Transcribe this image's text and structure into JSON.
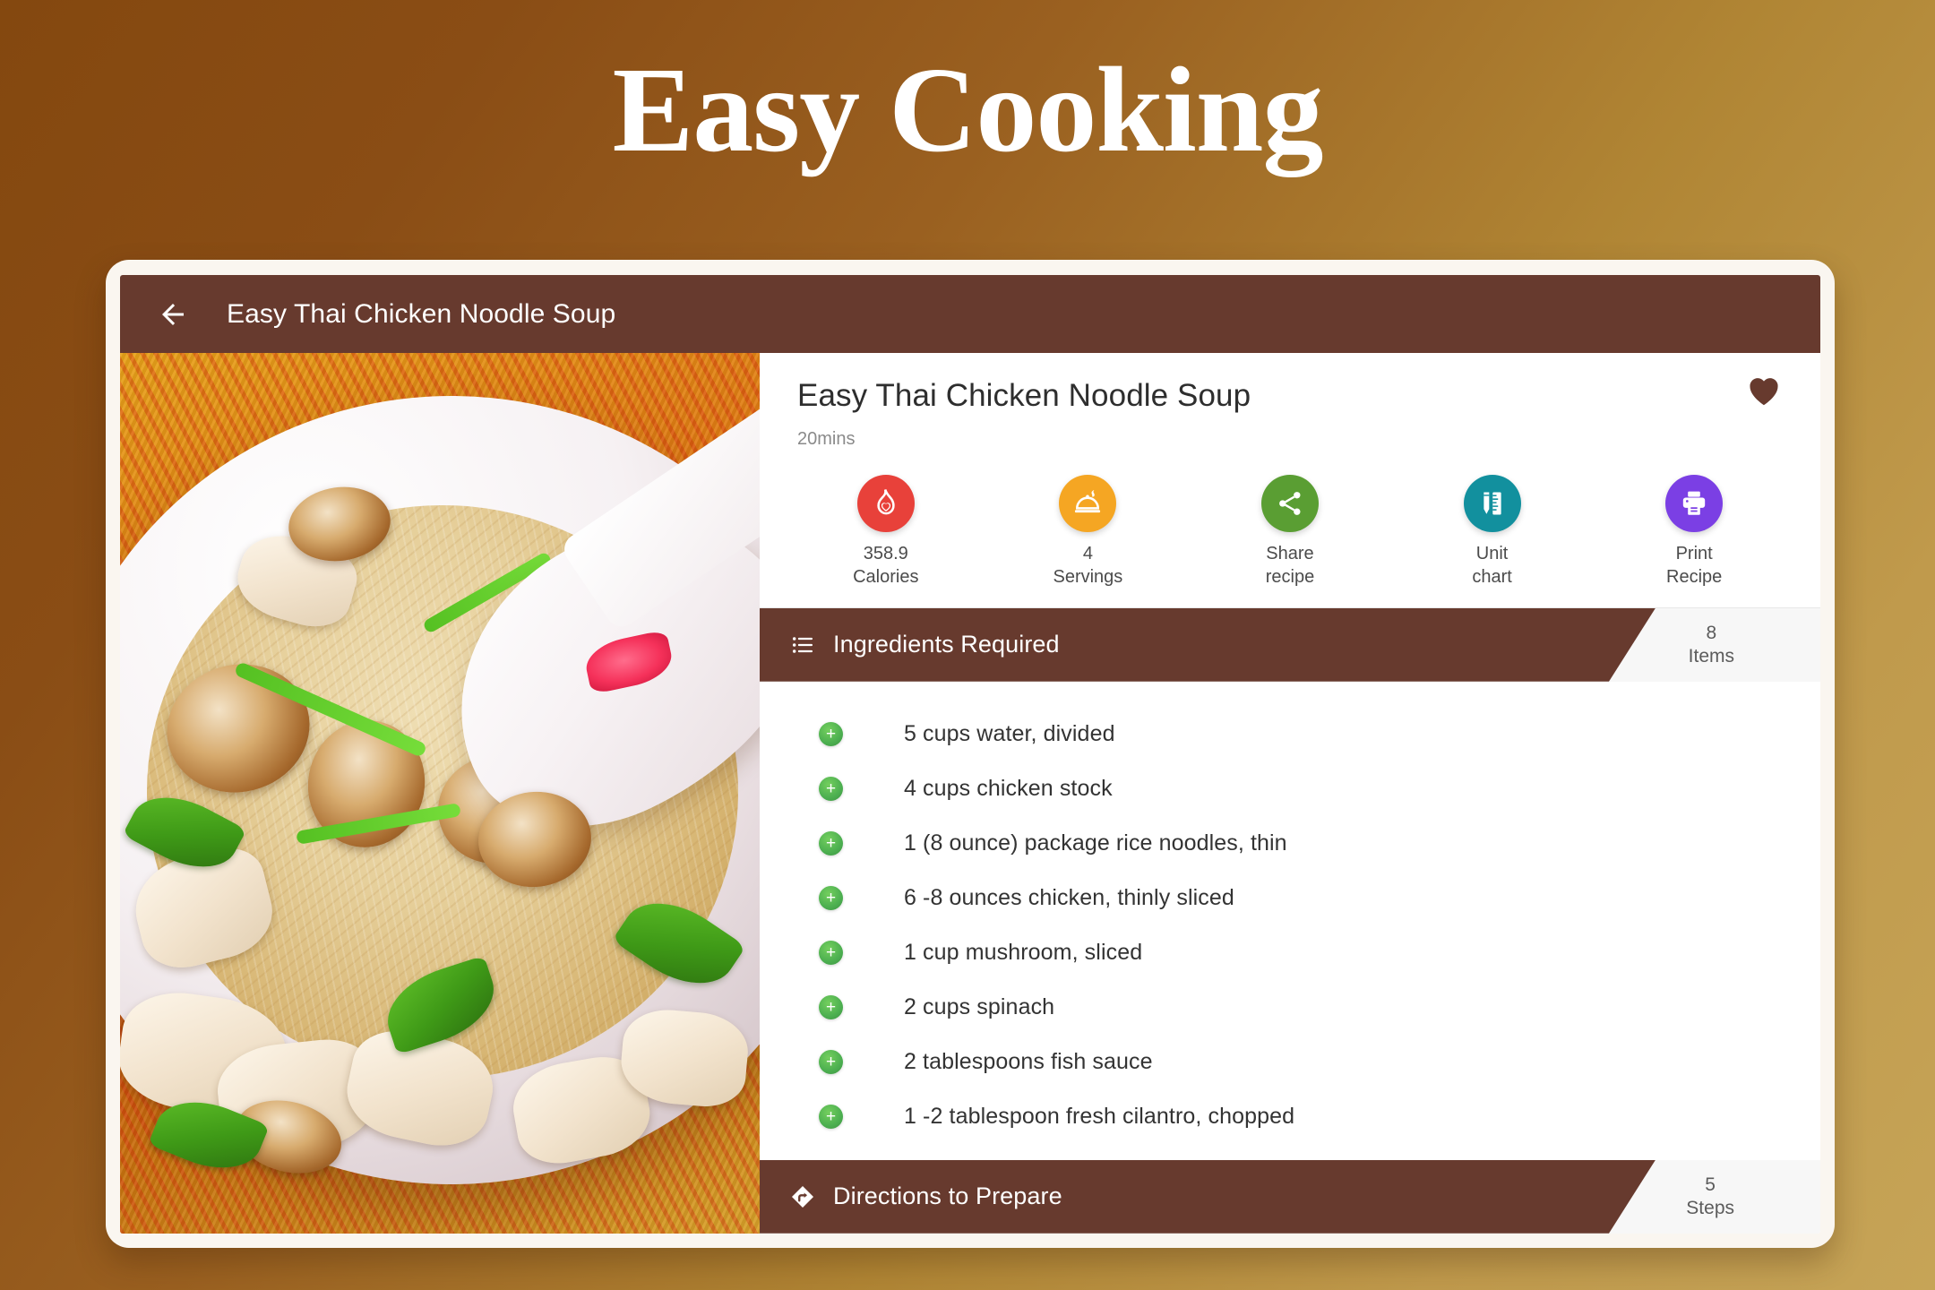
{
  "page": {
    "title": "Easy Cooking"
  },
  "appbar": {
    "back_icon": "arrow-left-icon",
    "title": "Easy Thai Chicken Noodle Soup"
  },
  "photo": {
    "alt": "Bowl of Thai chicken noodle soup with mushrooms, spinach and a white spoon"
  },
  "recipe": {
    "title": "Easy Thai Chicken Noodle Soup",
    "time": "20mins",
    "favorite_icon": "heart-icon",
    "favorited": true
  },
  "actions": [
    {
      "id": "calories",
      "icon": "flame-heart-icon",
      "color": "#e8413a",
      "value": "358.9",
      "label": "358.9\nCalories"
    },
    {
      "id": "servings",
      "icon": "cloche-icon",
      "color": "#f5a623",
      "value": "4",
      "label": "4\nServings"
    },
    {
      "id": "share-recipe",
      "icon": "share-icon",
      "color": "#5a9e33",
      "value": "Share",
      "label": "Share\nrecipe"
    },
    {
      "id": "unit-chart",
      "icon": "ruler-pencil-icon",
      "color": "#12909e",
      "value": "Unit",
      "label": "Unit\nchart"
    },
    {
      "id": "print-recipe",
      "icon": "printer-icon",
      "color": "#7b3fe4",
      "value": "Print",
      "label": "Print\nRecipe"
    }
  ],
  "ingredients_section": {
    "icon": "list-icon",
    "title": "Ingredients Required",
    "count": "8",
    "count_unit": "Items",
    "add_icon": "plus-icon",
    "items": [
      "5 cups water, divided",
      "4 cups chicken stock",
      "1 (8 ounce) package rice noodles, thin",
      "6 -8 ounces chicken, thinly sliced",
      "1 cup mushroom, sliced",
      "2 cups spinach",
      "2 tablespoons fish sauce",
      "1 -2 tablespoon fresh cilantro, chopped"
    ]
  },
  "directions_section": {
    "icon": "directions-icon",
    "title": "Directions to Prepare",
    "count": "5",
    "count_unit": "Steps"
  },
  "colors": {
    "brand_brown": "#673a2e",
    "background_start": "#84480f",
    "background_end": "#c6a457",
    "card_bezel": "#faf6f0",
    "add_green": "#4caf50"
  }
}
